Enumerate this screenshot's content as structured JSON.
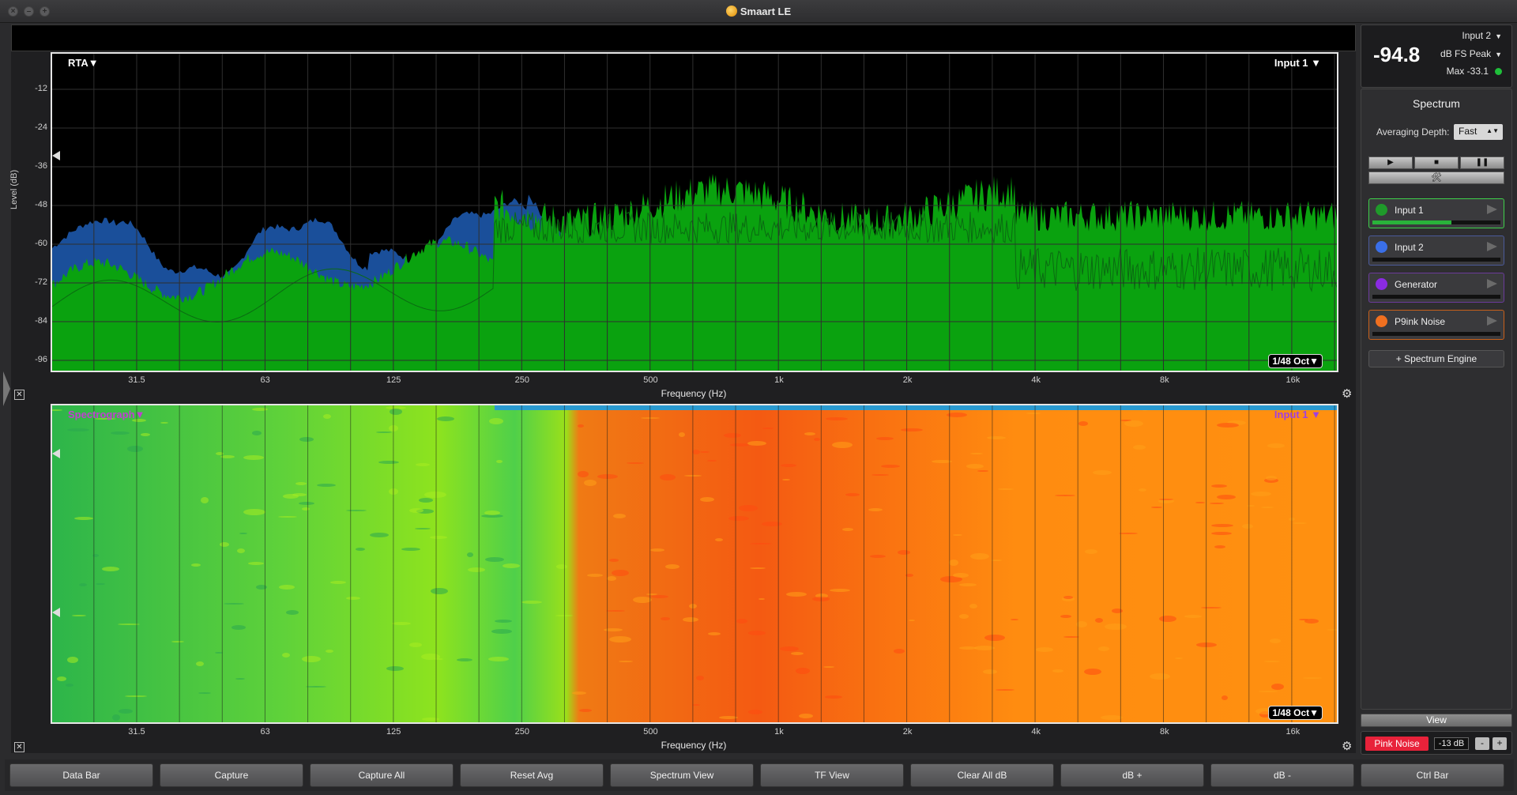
{
  "window": {
    "title": "Smaart LE",
    "controls": [
      "×",
      "–",
      "+"
    ]
  },
  "rta": {
    "mode_label": "RTA▼",
    "source_label": "Input 1 ▼",
    "resolution_label": "1/48 Oct▼",
    "ylabel": "Level (dB)",
    "yticks": [
      "-12",
      "-24",
      "-36",
      "-48",
      "-60",
      "-72",
      "-84",
      "-96"
    ],
    "xticks": [
      "31.5",
      "63",
      "125",
      "250",
      "500",
      "1k",
      "2k",
      "4k",
      "8k",
      "16k"
    ],
    "xlabel": "Frequency (Hz)"
  },
  "spectrograph": {
    "mode_label": "Spectrograph▼",
    "source_label": "Input 1 ▼",
    "resolution_label": "1/48 Oct▼",
    "xticks": [
      "31.5",
      "63",
      "125",
      "250",
      "500",
      "1k",
      "2k",
      "4k",
      "8k",
      "16k"
    ],
    "xlabel": "Frequency (Hz)"
  },
  "meter": {
    "value": "-94.8",
    "input": "Input 2",
    "units": "dB FS Peak",
    "max": "Max -33.1"
  },
  "panel": {
    "title": "Spectrum",
    "averaging_label": "Averaging Depth:",
    "averaging_value": "Fast",
    "transport": [
      "▶",
      "■",
      "❚❚"
    ],
    "tools_icon": "wrench-icon",
    "inputs": [
      {
        "label": "Input 1",
        "color": "#1f9a2a",
        "border": "#3ed14a",
        "level": 0.62,
        "level_color": "#29b33a"
      },
      {
        "label": "Input 2",
        "color": "#3a6fe8",
        "border": "#4a5a9a",
        "level": 0.0,
        "level_color": "#3a6fe8"
      },
      {
        "label": "Generator",
        "color": "#8a2be2",
        "border": "#6a3a9a",
        "level": 0.0,
        "level_color": "#8a2be2"
      },
      {
        "label": "P9ink Noise",
        "color": "#f07020",
        "border": "#c8601a",
        "level": 0.0,
        "level_color": "#f07020"
      }
    ],
    "engine_button": "+ Spectrum Engine"
  },
  "view_button": "View",
  "generator": {
    "button": "Pink Noise",
    "level": "-13 dB",
    "minus": "-",
    "plus": "+"
  },
  "bottom_bar": [
    "Data Bar",
    "Capture",
    "Capture All",
    "Reset Avg",
    "Spectrum View",
    "TF View",
    "Clear All dB",
    "dB +",
    "dB -",
    "Ctrl Bar"
  ]
}
